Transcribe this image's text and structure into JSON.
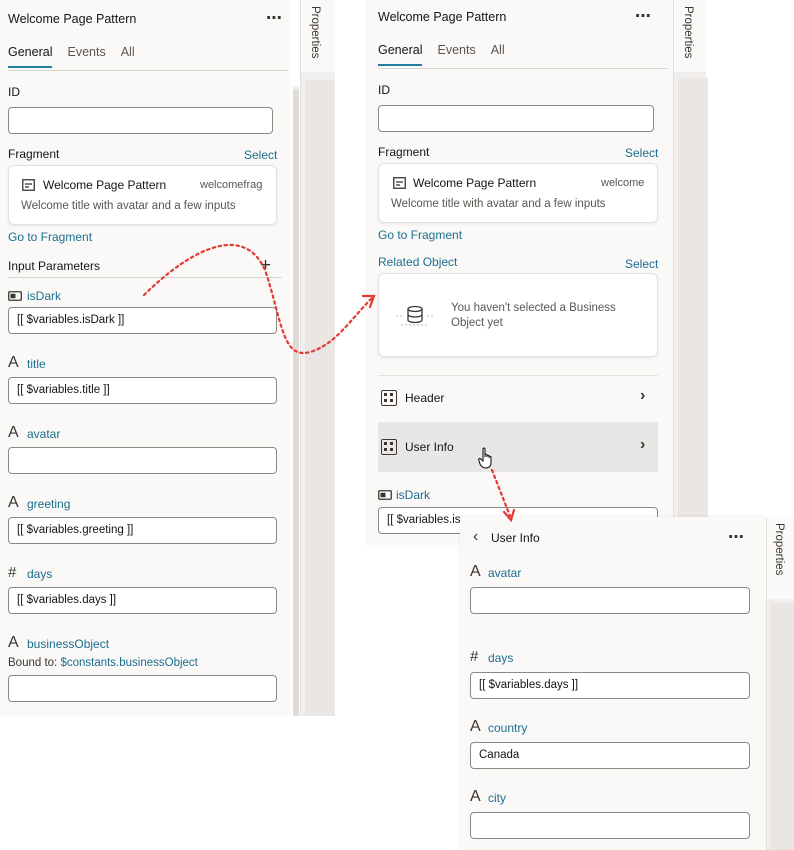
{
  "panel1": {
    "title": "Welcome Page Pattern",
    "tabs": [
      "General",
      "Events",
      "All"
    ],
    "id_label": "ID",
    "id_value": "",
    "fragment_label": "Fragment",
    "select_label": "Select",
    "fragment_card": {
      "title": "Welcome Page Pattern",
      "id": "welcomefrag",
      "description": "Welcome title with avatar and a few inputs"
    },
    "go_to_fragment": "Go to Fragment",
    "input_parameters_label": "Input Parameters",
    "params": [
      {
        "name": "isDark",
        "value": "[[ $variables.isDark ]]"
      },
      {
        "name": "title",
        "value": "[[ $variables.title ]]"
      },
      {
        "name": "avatar",
        "value": ""
      },
      {
        "name": "greeting",
        "value": "[[ $variables.greeting ]]"
      },
      {
        "name": "days",
        "value": "[[ $variables.days ]]"
      },
      {
        "name": "businessObject",
        "value": ""
      }
    ],
    "bound_to_label": "Bound to:",
    "bound_to_value": "$constants.businessObject",
    "rail_label": "Properties"
  },
  "panel2": {
    "title": "Welcome Page Pattern",
    "tabs": [
      "General",
      "Events",
      "All"
    ],
    "id_label": "ID",
    "id_value": "",
    "fragment_label": "Fragment",
    "select_label": "Select",
    "fragment_card": {
      "title": "Welcome Page Pattern",
      "id": "welcome",
      "description": "Welcome title with avatar and a few inputs"
    },
    "go_to_fragment": "Go to Fragment",
    "related_object_label": "Related Object",
    "related_select_label": "Select",
    "related_empty_text": "You haven't selected a Business Object yet",
    "rows": [
      "Header",
      "User Info"
    ],
    "param": {
      "name": "isDark",
      "value": "[[ $variables.is"
    },
    "rail_label": "Properties"
  },
  "panel3": {
    "title": "User Info",
    "params": [
      {
        "name": "avatar",
        "value": ""
      },
      {
        "name": "days",
        "value": "[[ $variables.days ]]"
      },
      {
        "name": "country",
        "value": "Canada"
      },
      {
        "name": "city",
        "value": ""
      }
    ],
    "rail_label": "Properties"
  },
  "colors": {
    "accent": "#227e9e",
    "link": "#1a6e8e",
    "panel_bg": "#fbf9f8",
    "arrow": "#e53935"
  }
}
